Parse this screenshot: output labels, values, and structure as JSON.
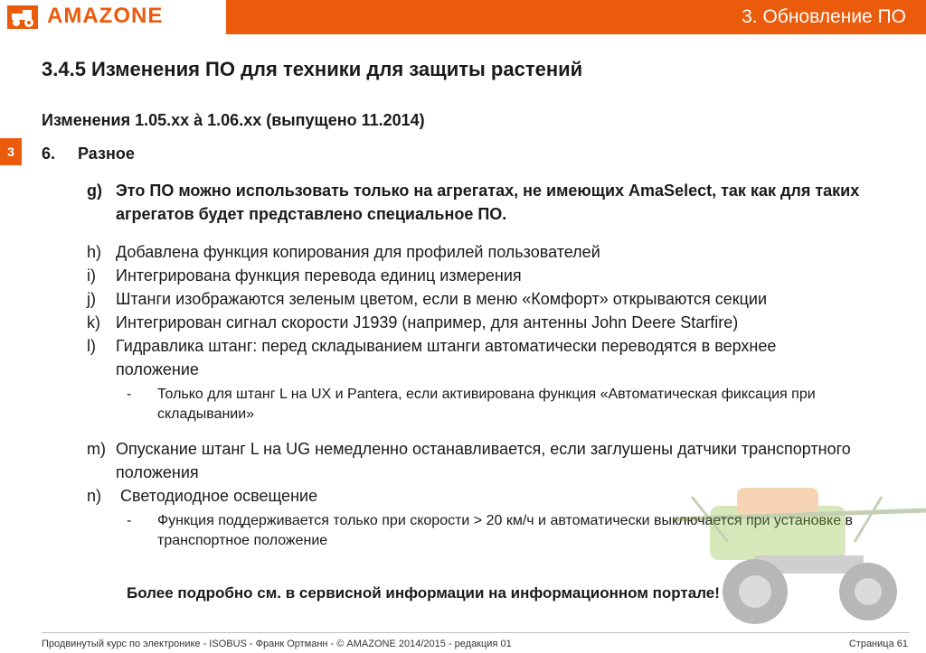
{
  "brand": {
    "logo_text": "AMAZONE",
    "accent": "#ea5b0c"
  },
  "header": {
    "section_title": "3.  Обновление ПО",
    "section_tab": "3"
  },
  "page": {
    "title": "3.4.5 Изменения ПО для техники для защиты растений",
    "subtitle": "Изменения 1.05.xx à 1.06.xx (выпущено 11.2014)",
    "heading_num": "6.",
    "heading_text": "Разное"
  },
  "items": {
    "g": {
      "marker": "g)",
      "text": "Это ПО можно использовать только на агрегатах, не имеющих AmaSelect, так как для таких агрегатов будет представлено специальное ПО."
    },
    "h": {
      "marker": "h)",
      "text": "Добавлена функция копирования для профилей пользователей"
    },
    "i": {
      "marker": "i)",
      "text": "Интегрирована функция перевода единиц измерения"
    },
    "j": {
      "marker": "j)",
      "text": "Штанги изображаются зеленым цветом, если в меню «Комфорт» открываются секции"
    },
    "k": {
      "marker": "k)",
      "text": "Интегрирован сигнал скорости J1939 (например, для антенны John Deere Starfire)"
    },
    "l": {
      "marker": "l)",
      "text": "Гидравлика штанг: перед складыванием штанги автоматически переводятся в верхнее положение"
    },
    "l_sub": {
      "dash": "-",
      "text": "Только для штанг L на UX и Pantera, если активирована функция «Автоматическая фиксация при складывании»"
    },
    "m": {
      "marker": "m)",
      "text": "Опускание штанг L на UG немедленно останавливается, если заглушены датчики транспортного положения"
    },
    "n": {
      "marker": "n)",
      "text": " Светодиодное освещение"
    },
    "n_sub": {
      "dash": "-",
      "text": "Функция поддерживается только при скорости > 20 км/ч и автоматически выключается при установке в транспортное положение"
    }
  },
  "note": "Более подробно см. в сервисной информации на информационном портале!",
  "footer": {
    "left": "Продвинутый курс по электронике - ISOBUS - Франк Ортманн - © AMAZONE 2014/2015 - редакция 01",
    "right": "Страница 61"
  }
}
